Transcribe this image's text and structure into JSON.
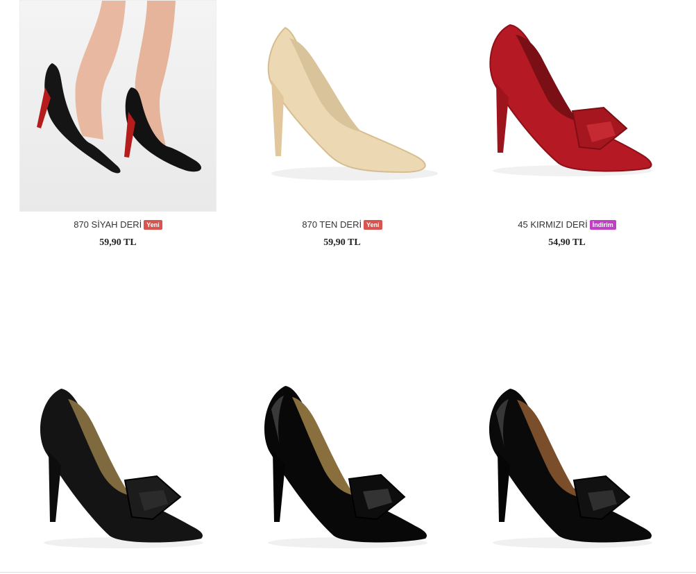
{
  "products": [
    {
      "name": "870 SİYAH DERİ",
      "badge": "Yeni",
      "badge_color": "#d9534f",
      "price": "59,90 TL",
      "image_icon": "black-leather-pump-worn-photo"
    },
    {
      "name": "870 TEN DERİ",
      "badge": "Yeni",
      "badge_color": "#d9534f",
      "price": "59,90 TL",
      "image_icon": "nude-leather-pump"
    },
    {
      "name": "45 KIRMIZI DERİ",
      "badge": "İndirim",
      "badge_color": "#c13fc7",
      "price": "54,90 TL",
      "image_icon": "red-bow-pump"
    },
    {
      "image_icon": "black-matte-bow-pump"
    },
    {
      "image_icon": "black-patent-bow-pump"
    },
    {
      "image_icon": "black-patent-bow-pump-2"
    }
  ]
}
